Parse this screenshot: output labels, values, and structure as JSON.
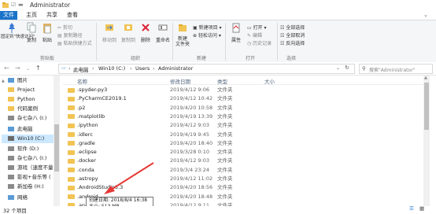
{
  "window": {
    "title": "Administrator"
  },
  "tabs": [
    {
      "label": "文件"
    },
    {
      "label": "主页"
    },
    {
      "label": "共享"
    },
    {
      "label": "查看"
    }
  ],
  "ribbon": {
    "pin": "固定到\"快速访问\"",
    "copy": "复制",
    "paste": "粘贴",
    "cut": "剪切",
    "copy_path": "复制路径",
    "paste_shortcut": "粘贴快捷方式",
    "move_to": "移动到",
    "copy_to": "复制到",
    "delete": "删除",
    "rename": "重命名",
    "new_folder": "新建\n文件夹",
    "new_item": "新建项目 ▾",
    "easy_access": "轻松访问 ▾",
    "properties": "属性",
    "open": "打开 ▾",
    "edit": "编辑",
    "history": "历史记录",
    "select_all": "全部选择",
    "select_none": "全部取消",
    "invert": "反向选择",
    "groups": {
      "clipboard": "剪贴板",
      "organize": "组织",
      "new": "新建",
      "open": "打开",
      "select": "选择"
    }
  },
  "address": {
    "crumbs": [
      "此电脑",
      "Win10 (C:)",
      "Users",
      "Administrator"
    ],
    "search_placeholder": "搜索\"Administrator\""
  },
  "nav": {
    "items": [
      {
        "label": "图片",
        "icon": "pictures-icon"
      },
      {
        "label": "Project",
        "icon": "folder-icon"
      },
      {
        "label": "Python",
        "icon": "folder-icon"
      },
      {
        "label": "代码案例",
        "icon": "folder-icon"
      },
      {
        "label": "杂七杂八 (I:)",
        "icon": "drive-icon"
      },
      {
        "label": "此电脑",
        "icon": "computer-icon"
      },
      {
        "label": "Win10 (C:)",
        "icon": "drive-icon"
      },
      {
        "label": "软件 (D:)",
        "icon": "drive-icon"
      },
      {
        "label": "杂七杂八 (I:)",
        "icon": "drive-icon"
      },
      {
        "label": "游戏（速度不量",
        "icon": "drive-icon"
      },
      {
        "label": "影视+音乐等 (",
        "icon": "drive-icon"
      },
      {
        "label": "新加卷 (H:)",
        "icon": "drive-icon"
      },
      {
        "label": "网络",
        "icon": "network-icon"
      }
    ]
  },
  "columns": {
    "name": "名称",
    "date": "修改日期",
    "type": "类型",
    "size": "大小"
  },
  "files": [
    {
      "name": ".spyder-py3",
      "date": "2019/4/12 9:06",
      "type": "文件夹"
    },
    {
      "name": ".PyCharmCE2019.1",
      "date": "2019/4/12 10:42",
      "type": "文件夹"
    },
    {
      "name": ".p2",
      "date": "2019/4/20 10:58",
      "type": "文件夹"
    },
    {
      "name": ".matplotlib",
      "date": "2019/4/19 13:39",
      "type": "文件夹"
    },
    {
      "name": ".ipython",
      "date": "2019/4/12 9:03",
      "type": "文件夹"
    },
    {
      "name": ".idlerc",
      "date": "2019/4/19 9:45",
      "type": "文件夹"
    },
    {
      "name": ".gradle",
      "date": "2019/4/20 18:40",
      "type": "文件夹"
    },
    {
      "name": ".eclipse",
      "date": "2019/3/28 0:10",
      "type": "文件夹"
    },
    {
      "name": ".docker",
      "date": "2019/4/12 9:03",
      "type": "文件夹"
    },
    {
      "name": ".conda",
      "date": "2019/3/4 23:24",
      "type": "文件夹"
    },
    {
      "name": ".astropy",
      "date": "2019/4/12 11:02",
      "type": "文件夹"
    },
    {
      "name": ".AndroidStudio3.3",
      "date": "2019/4/20 18:56",
      "type": "文件夹"
    },
    {
      "name": ".android",
      "date": "2019/4/20 18:48",
      "type": "文件夹"
    },
    {
      "name": ".anaconda",
      "date": "2019/4/12 9:11",
      "type": "文件夹"
    }
  ],
  "tooltip": {
    "line1": "创建日期: 2018/8/4 16:38",
    "line2": "大小: 513 MB"
  },
  "status": {
    "count": "32 个项目"
  },
  "colors": {
    "file_tab": "#1a73c8",
    "folder": "#f1c453",
    "selected_drive": "#cce8ff",
    "arrow": "#e53935"
  }
}
